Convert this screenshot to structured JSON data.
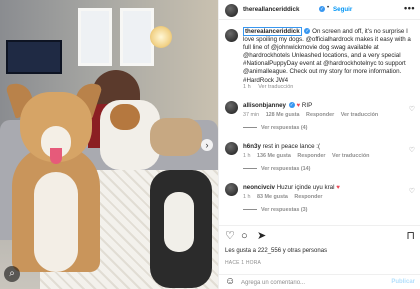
{
  "post": {
    "username": "thereallanceriddick",
    "follow_label": "Seguir",
    "more_label": "•••",
    "dot": "•"
  },
  "caption": {
    "username": "therealanceriddick",
    "text": "On screen and off, it's no surprise I love spoiling my dogs. @officialhardrock makes it easy with a full line of @johnwickmovie dog swag available at @hardrockhotels Unleashed locations, and a very special #NationalPuppyDay event at @hardrockhotelnyc to support @animalleague. Check out my story for more information. #HardRock JW4",
    "time": "1 h",
    "translate": "Ver traducción"
  },
  "comments": [
    {
      "username": "allisonbjanney",
      "text": "RIP",
      "time": "37 min",
      "likes": "128 Me gusta",
      "reply": "Responder",
      "translate": "Ver traducción",
      "replies": "Ver respuestas (4)"
    },
    {
      "username": "h6n3y",
      "text": "rest in peace lance :(",
      "time": "1 h",
      "likes": "136 Me gusta",
      "reply": "Responder",
      "translate": "Ver traducción",
      "replies": "Ver respuestas (14)"
    },
    {
      "username": "neoncivciv",
      "text": "Huzur içinde uyu kral",
      "time": "1 h",
      "likes": "83 Me gusta",
      "reply": "Responder",
      "translate": "",
      "replies": "Ver respuestas (3)"
    }
  ],
  "footer": {
    "likes_text": "Les gusta a 222_556 y otras personas",
    "date": "HACE 1 HORA",
    "comment_placeholder": "Agrega un comentario...",
    "publish_label": "Publicar"
  },
  "icons": {
    "heart": "♡",
    "comment": "○",
    "share": "➤",
    "save": "⊓",
    "smile": "☺",
    "next": "›",
    "search_glass": "⌕",
    "verified": "✓"
  },
  "colors": {
    "link_blue": "#0095f6",
    "verified_blue": "#3897f0",
    "muted": "#8e8e8e",
    "heart_red": "#ed4956"
  }
}
